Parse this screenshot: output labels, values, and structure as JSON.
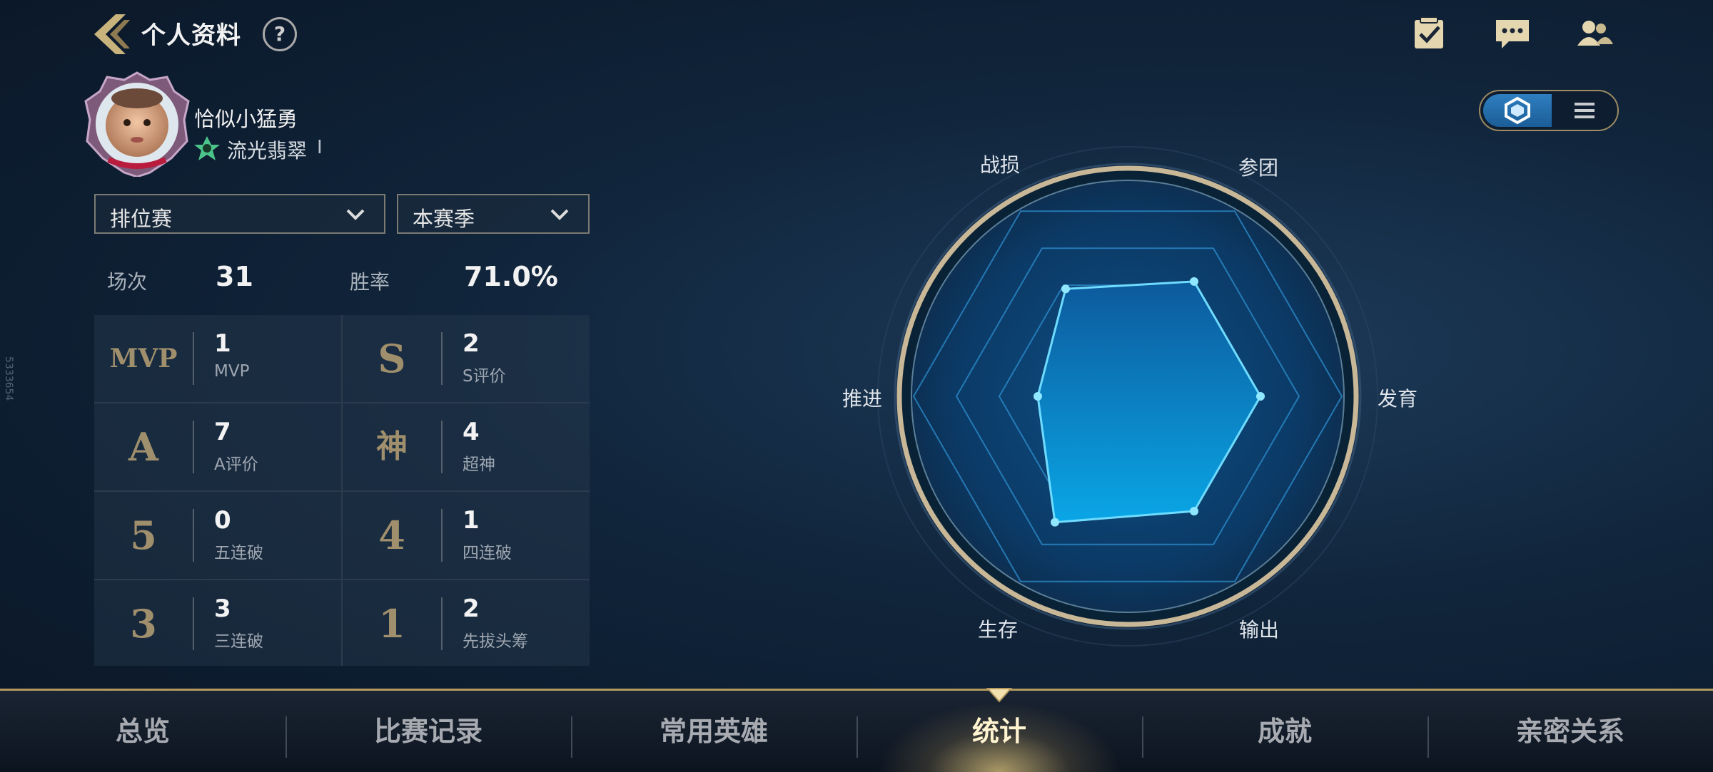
{
  "header": {
    "title": "个人资料",
    "help_label": "?"
  },
  "top_icons": [
    "checklist-icon",
    "chat-icon",
    "friends-icon"
  ],
  "profile": {
    "name": "恰似小猛勇",
    "rank": "流光翡翠",
    "rank_separator": "I"
  },
  "filters": {
    "mode": "排位赛",
    "season": "本赛季"
  },
  "summary": [
    {
      "label": "场次",
      "value": "31"
    },
    {
      "label": "胜率",
      "value": "71.0%"
    }
  ],
  "stats": [
    {
      "badge": "MVP",
      "value": "1",
      "label": "MVP"
    },
    {
      "badge": "S",
      "value": "2",
      "label": "S评价"
    },
    {
      "badge": "A",
      "value": "7",
      "label": "A评价"
    },
    {
      "badge": "神",
      "value": "4",
      "label": "超神"
    },
    {
      "badge": "5",
      "value": "0",
      "label": "五连破"
    },
    {
      "badge": "4",
      "value": "1",
      "label": "四连破"
    },
    {
      "badge": "3",
      "value": "3",
      "label": "三连破"
    },
    {
      "badge": "1",
      "value": "2",
      "label": "先拔头筹"
    }
  ],
  "side_id": "5333654",
  "radar": {
    "axes": [
      "战损",
      "参团",
      "发育",
      "输出",
      "生存",
      "推进"
    ],
    "values": [
      0.58,
      0.62,
      0.62,
      0.62,
      0.68,
      0.42
    ]
  },
  "view_toggle": {
    "selected": "radar",
    "options": [
      "hexagon-icon",
      "list-icon"
    ]
  },
  "nav": {
    "tabs": [
      "总览",
      "比赛记录",
      "常用英雄",
      "统计",
      "成就",
      "亲密关系"
    ],
    "active_index": 3
  },
  "colors": {
    "accent_gold": "#b59a5f",
    "radar_fill": "#0a8fd6",
    "radar_stroke": "#6fdcff"
  }
}
